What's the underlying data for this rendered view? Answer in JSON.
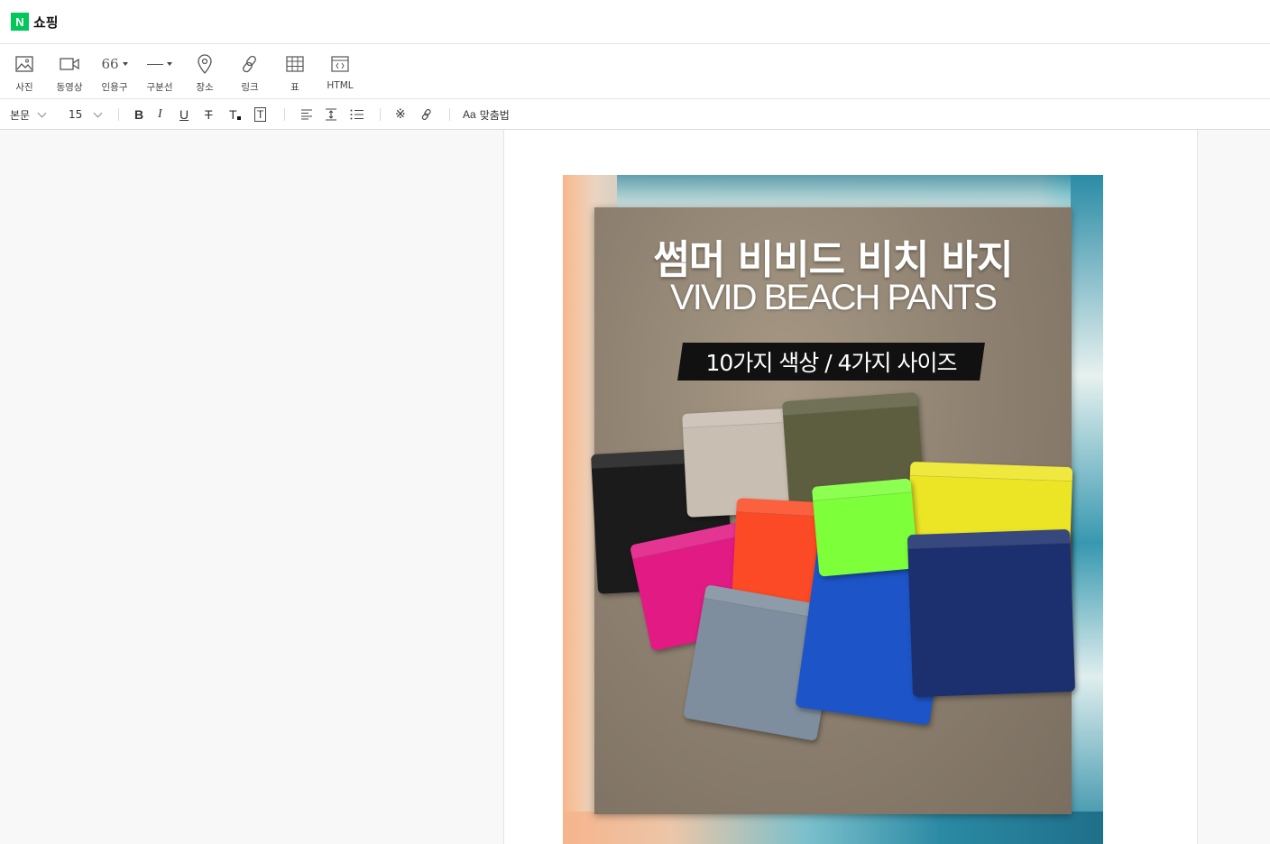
{
  "header": {
    "logo_letter": "N",
    "brand": "쇼핑"
  },
  "insert_toolbar": [
    {
      "label": "사진",
      "icon": "photo-icon"
    },
    {
      "label": "동영상",
      "icon": "video-icon"
    },
    {
      "label": "인용구",
      "icon": "quote-icon"
    },
    {
      "label": "구분선",
      "icon": "divider-icon"
    },
    {
      "label": "장소",
      "icon": "location-pin-icon"
    },
    {
      "label": "링크",
      "icon": "link-icon"
    },
    {
      "label": "표",
      "icon": "table-icon"
    },
    {
      "label": "HTML",
      "icon": "html-icon"
    }
  ],
  "format_toolbar": {
    "paragraph_style": "본문",
    "font_size": "15",
    "spellcheck_label": "맞춤법"
  },
  "product_image": {
    "title_ko": "썸머 비비드 비치 바지",
    "title_en": "VIVID BEACH PANTS",
    "badge": "10가지 색상 / 4가지 사이즈",
    "colors": [
      "#1b1b1b",
      "#c9beb2",
      "#5d5e3f",
      "#e21a84",
      "#fb4a25",
      "#7dff3a",
      "#ece525",
      "#1d55c8",
      "#1c2f6e",
      "#7f8e9e"
    ]
  }
}
